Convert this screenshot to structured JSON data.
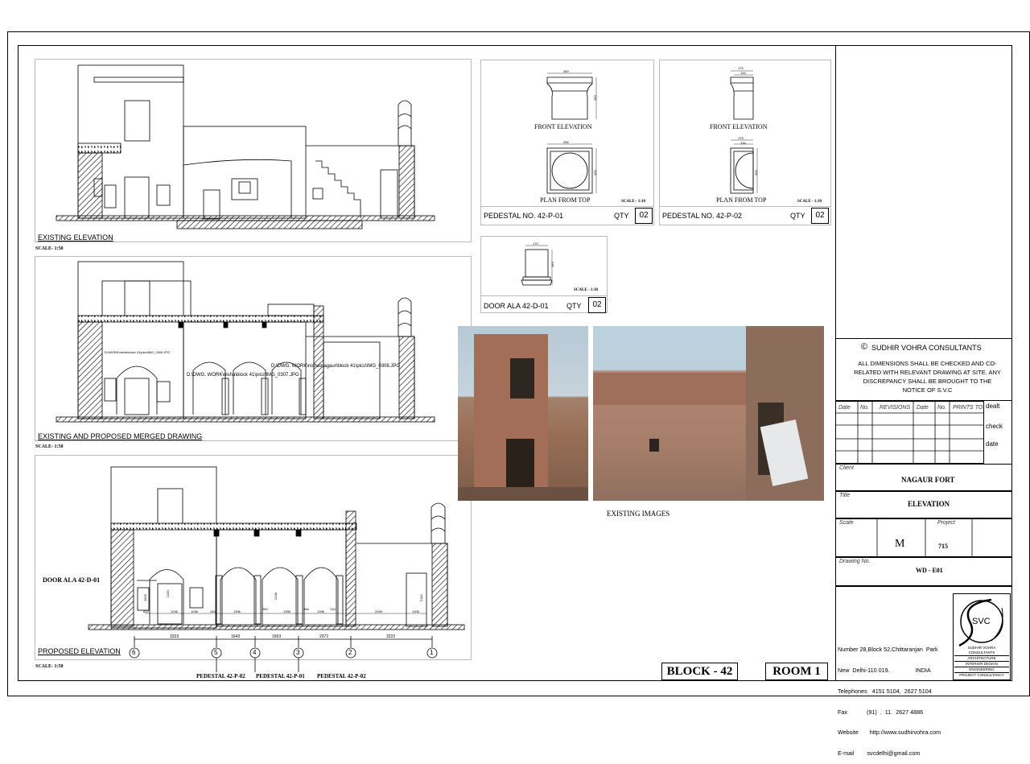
{
  "elevations": {
    "existing": {
      "label": "EXISTING ELEVATION",
      "scale": "SCALE- 1:50"
    },
    "merged": {
      "label": "EXISTING AND PROPOSED MERGED DRAWING",
      "scale": "SCALE- 1:50",
      "path_notes": [
        "D:\\WORK\\nisha\\block 41\\pics\\IMG_0305.JPG",
        "D:\\DWG. WORK\\nisha\\block 41\\pics\\IMG_0307.JPG",
        "D:\\DWG. WORK\\nisha\\nagaur\\block 41\\pics\\IMG_0308.JPG"
      ]
    },
    "proposed": {
      "label": "PROPOSED ELEVATION",
      "scale": "SCALE- 1:50",
      "door_callout": "DOOR ALA 42-D-01",
      "pedestal_callouts": [
        "PEDESTAL 42-P-02",
        "PEDESTAL 42-P-01",
        "PEDESTAL 42-P-02"
      ],
      "grid_marks": [
        "6",
        "5",
        "4",
        "3",
        "2",
        "1"
      ],
      "dimensions": [
        "3323",
        "1643",
        "1663",
        "2072",
        "3222"
      ],
      "small_dims": [
        "810",
        "1046",
        "1036",
        "340",
        "1396",
        "260",
        "1396",
        "268",
        "1396",
        "134",
        "2099",
        "1006"
      ],
      "vertical_dims": [
        "1500",
        "2150",
        "2148",
        "2110"
      ]
    }
  },
  "pedestal_p01": {
    "front_label": "FRONT ELEVATION",
    "plan_label": "PLAN FROM TOP",
    "scale": "SCALE - 1:10",
    "name": "PEDESTAL  NO. 42-P-01",
    "qty_label": "QTY",
    "qty": "02",
    "dims": [
      "350",
      "300",
      "350",
      "266",
      "300"
    ]
  },
  "pedestal_p02": {
    "front_label": "FRONT ELEVATION",
    "plan_label": "PLAN FROM TOP",
    "scale": "SCALE - 1:10",
    "name": "PEDESTAL  NO. 42-P-02",
    "qty_label": "QTY",
    "qty": "02",
    "dims": [
      "175",
      "134",
      "175",
      "134",
      "300"
    ]
  },
  "door_ala": {
    "scale": "SCALE - 1:10",
    "name": "DOOR ALA 42-D-01",
    "qty_label": "QTY",
    "qty": "02",
    "dims": [
      "170",
      "415"
    ]
  },
  "photos": {
    "caption": "EXISTING IMAGES"
  },
  "title_block": {
    "company": "SUDHIR  VOHRA  CONSULTANTS",
    "copyright_symbol": "©",
    "note": "ALL DIMENSIONS SHALL BE CHECKED AND CO-RELATED WITH RELEVANT DRAWING AT SITE. ANY DISCREPANCY SHALL BE BROUGHT TO THE NOTICE OF",
    "notice_of": "S.V.C",
    "revision_headers": [
      "Date",
      "No.",
      "REVISIONS",
      "Date",
      "No.",
      "PRINTS TO"
    ],
    "side_labels": [
      "dealt",
      "check",
      "date"
    ],
    "client_label": "Client",
    "client": "NAGAUR FORT",
    "title_label": "Title",
    "title": "ELEVATION",
    "scale_label": "Scale",
    "scale_value": "M",
    "project_label": "Project",
    "project": "715",
    "drawing_label": "Drawing No.",
    "drawing_no": "WD - E01",
    "address_lines": [
      "Number 28,Block 52,Chittaranjan  Park",
      "New  Delhi-110 019.                INDIA",
      "Telephones   4151 5104,  2627 5104",
      "Fax            (91)  .  11.  2627 4886",
      "Website       http://www.sudhirvohra.com",
      "E-mail        svcdelhi@gmail.com"
    ],
    "logo_text": "SVC",
    "logo_lines": [
      "SUDHIR VOHRA",
      "CONSULTANTS",
      "ARCHITECTURE",
      "INTERIOR DESIGN",
      "ENGINEERING",
      "PROJECT CONSULTANCY"
    ]
  },
  "block_label": "BLOCK - 42",
  "room_label": "ROOM 1"
}
